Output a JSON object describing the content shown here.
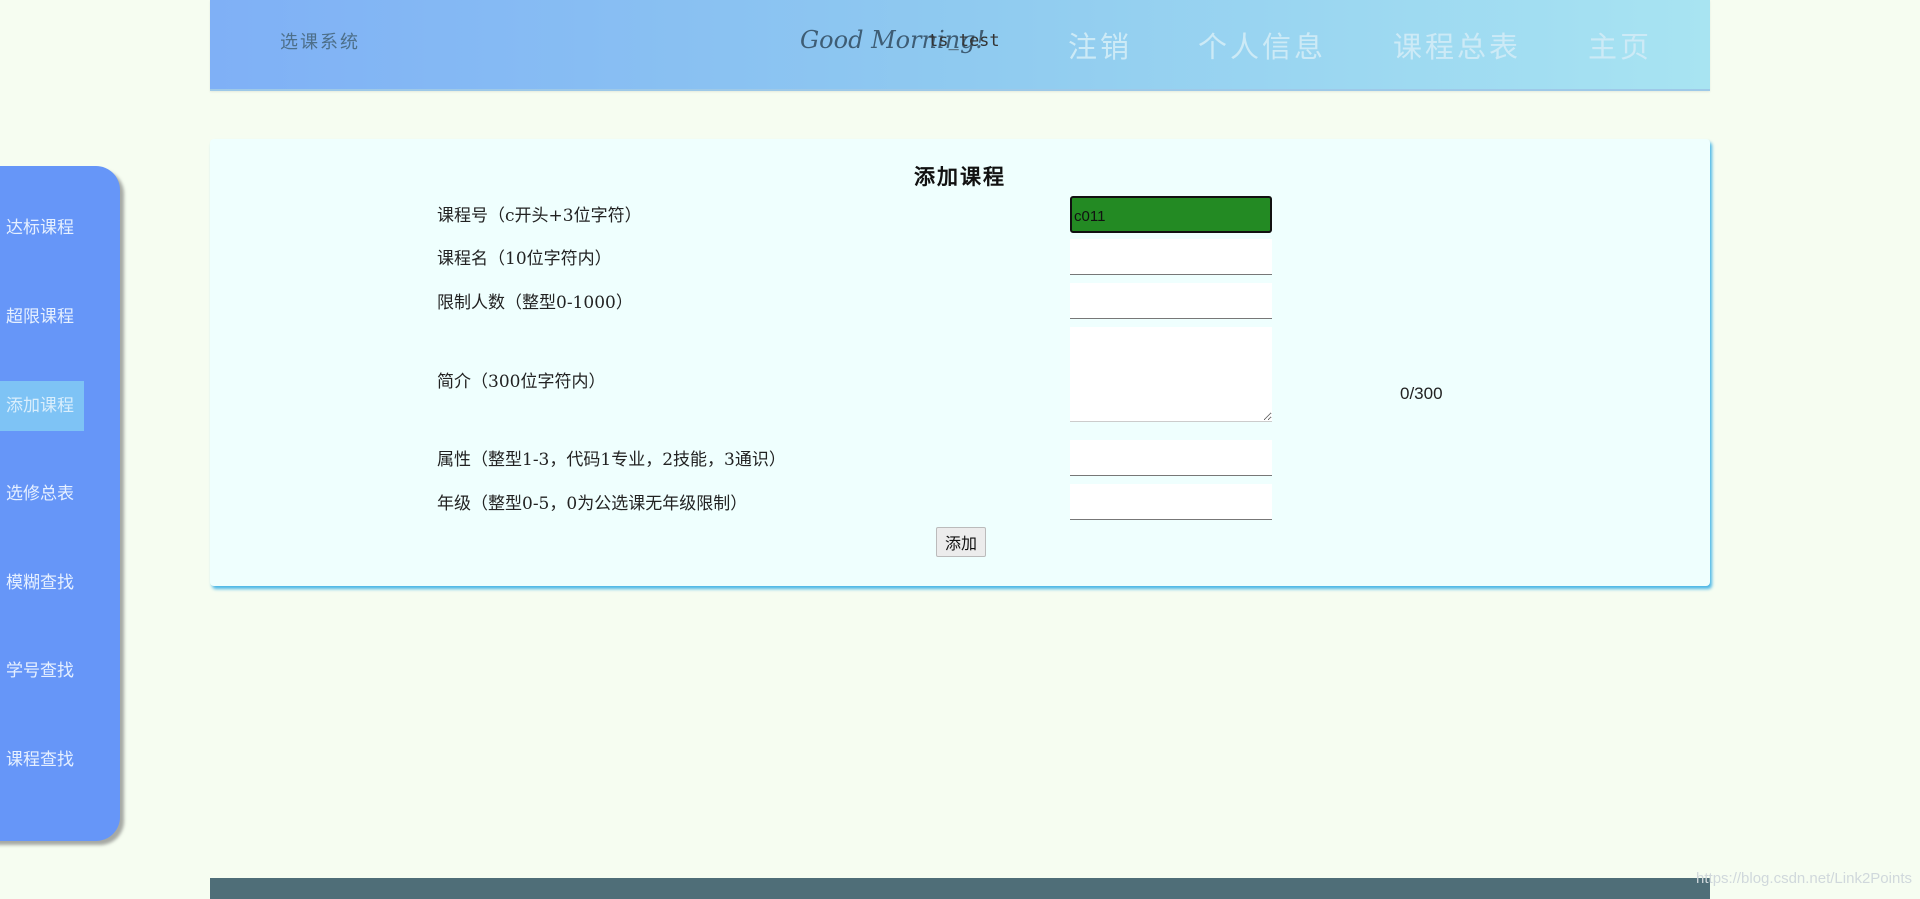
{
  "header": {
    "brand": "选课系统",
    "greeting": "Good Morning!",
    "username": "ts_test",
    "nav": [
      "注销",
      "个人信息",
      "课程总表",
      "主页"
    ]
  },
  "sidebar": {
    "items": [
      {
        "label": "达标课程"
      },
      {
        "label": "超限课程"
      },
      {
        "label": "添加课程",
        "active": true
      },
      {
        "label": "选修总表"
      },
      {
        "label": "模糊查找"
      },
      {
        "label": "学号查找"
      },
      {
        "label": "课程查找"
      }
    ]
  },
  "form": {
    "title": "添加课程",
    "fields": {
      "course_id": {
        "label": "课程号（c开头+3位字符）",
        "value": "c011"
      },
      "course_name": {
        "label": "课程名（10位字符内）",
        "value": ""
      },
      "limit": {
        "label": "限制人数（整型0-1000）",
        "value": ""
      },
      "intro": {
        "label": "简介（300位字符内）",
        "value": "",
        "counter": "0/300"
      },
      "attribute": {
        "label": "属性（整型1-3，代码1专业，2技能，3通识）",
        "value": ""
      },
      "grade": {
        "label": "年级（整型0-5，0为公选课无年级限制）",
        "value": ""
      }
    },
    "submit_label": "添加"
  },
  "watermark": "https://blog.csdn.net/Link2Points",
  "colors": {
    "sidebar": "#6696f8",
    "sidebar_active": "#7ec3f5",
    "panel": "#effffe",
    "focused_input": "#238a23",
    "footer": "#4f6e78"
  }
}
